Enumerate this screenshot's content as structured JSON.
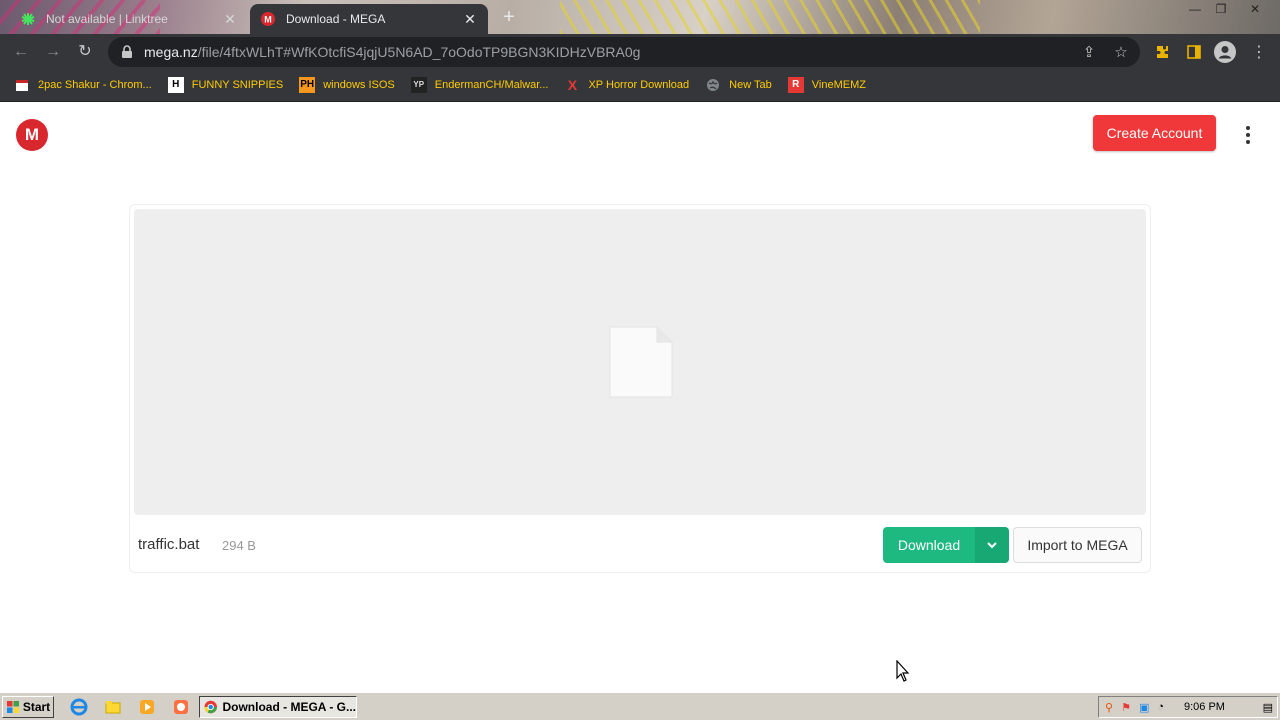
{
  "browser": {
    "tabs": [
      {
        "title": "Not available | Linktree",
        "active": false
      },
      {
        "title": "Download - MEGA",
        "active": true
      }
    ],
    "url_host": "mega.nz",
    "url_path": "/file/4ftxWLhT#WfKOtcfiS4jqjU5N6AD_7oOdoTP9BGN3KIDHzVBRA0g",
    "bookmarks": [
      {
        "label": "2pac Shakur - Chrom..."
      },
      {
        "label": "FUNNY SNIPPIES",
        "icon_text": "H"
      },
      {
        "label": "windows ISOS",
        "icon_text": "PH"
      },
      {
        "label": "EndermanCH/Malwar...",
        "icon_text": "YP"
      },
      {
        "label": "XP Horror Download",
        "icon_text": "X"
      },
      {
        "label": "New Tab"
      },
      {
        "label": "VineMEMZ",
        "icon_text": "R"
      }
    ]
  },
  "page": {
    "logo_text": "M",
    "create_account": "Create Account",
    "file_name": "traffic.bat",
    "file_size": "294 B",
    "download_label": "Download",
    "import_label": "Import to MEGA"
  },
  "taskbar": {
    "start_label": "Start",
    "task_label": "Download - MEGA - G...",
    "clock": "9:06 PM"
  },
  "colors": {
    "mega_red": "#d9272e",
    "create_btn": "#f0373a",
    "download_green": "#1eb980",
    "bookmark_text": "#ffcc00"
  }
}
